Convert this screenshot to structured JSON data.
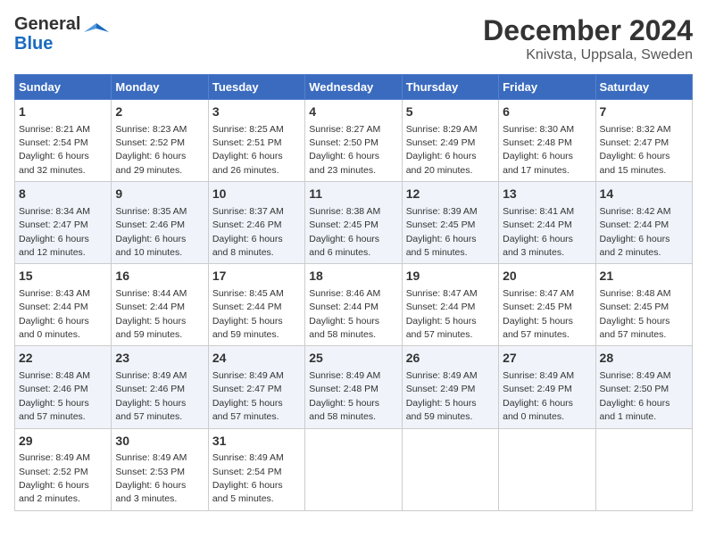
{
  "header": {
    "logo_line1": "General",
    "logo_line2": "Blue",
    "title": "December 2024",
    "subtitle": "Knivsta, Uppsala, Sweden"
  },
  "calendar": {
    "days_of_week": [
      "Sunday",
      "Monday",
      "Tuesday",
      "Wednesday",
      "Thursday",
      "Friday",
      "Saturday"
    ],
    "weeks": [
      [
        {
          "day": "1",
          "detail": "Sunrise: 8:21 AM\nSunset: 2:54 PM\nDaylight: 6 hours\nand 32 minutes."
        },
        {
          "day": "2",
          "detail": "Sunrise: 8:23 AM\nSunset: 2:52 PM\nDaylight: 6 hours\nand 29 minutes."
        },
        {
          "day": "3",
          "detail": "Sunrise: 8:25 AM\nSunset: 2:51 PM\nDaylight: 6 hours\nand 26 minutes."
        },
        {
          "day": "4",
          "detail": "Sunrise: 8:27 AM\nSunset: 2:50 PM\nDaylight: 6 hours\nand 23 minutes."
        },
        {
          "day": "5",
          "detail": "Sunrise: 8:29 AM\nSunset: 2:49 PM\nDaylight: 6 hours\nand 20 minutes."
        },
        {
          "day": "6",
          "detail": "Sunrise: 8:30 AM\nSunset: 2:48 PM\nDaylight: 6 hours\nand 17 minutes."
        },
        {
          "day": "7",
          "detail": "Sunrise: 8:32 AM\nSunset: 2:47 PM\nDaylight: 6 hours\nand 15 minutes."
        }
      ],
      [
        {
          "day": "8",
          "detail": "Sunrise: 8:34 AM\nSunset: 2:47 PM\nDaylight: 6 hours\nand 12 minutes."
        },
        {
          "day": "9",
          "detail": "Sunrise: 8:35 AM\nSunset: 2:46 PM\nDaylight: 6 hours\nand 10 minutes."
        },
        {
          "day": "10",
          "detail": "Sunrise: 8:37 AM\nSunset: 2:46 PM\nDaylight: 6 hours\nand 8 minutes."
        },
        {
          "day": "11",
          "detail": "Sunrise: 8:38 AM\nSunset: 2:45 PM\nDaylight: 6 hours\nand 6 minutes."
        },
        {
          "day": "12",
          "detail": "Sunrise: 8:39 AM\nSunset: 2:45 PM\nDaylight: 6 hours\nand 5 minutes."
        },
        {
          "day": "13",
          "detail": "Sunrise: 8:41 AM\nSunset: 2:44 PM\nDaylight: 6 hours\nand 3 minutes."
        },
        {
          "day": "14",
          "detail": "Sunrise: 8:42 AM\nSunset: 2:44 PM\nDaylight: 6 hours\nand 2 minutes."
        }
      ],
      [
        {
          "day": "15",
          "detail": "Sunrise: 8:43 AM\nSunset: 2:44 PM\nDaylight: 6 hours\nand 0 minutes."
        },
        {
          "day": "16",
          "detail": "Sunrise: 8:44 AM\nSunset: 2:44 PM\nDaylight: 5 hours\nand 59 minutes."
        },
        {
          "day": "17",
          "detail": "Sunrise: 8:45 AM\nSunset: 2:44 PM\nDaylight: 5 hours\nand 59 minutes."
        },
        {
          "day": "18",
          "detail": "Sunrise: 8:46 AM\nSunset: 2:44 PM\nDaylight: 5 hours\nand 58 minutes."
        },
        {
          "day": "19",
          "detail": "Sunrise: 8:47 AM\nSunset: 2:44 PM\nDaylight: 5 hours\nand 57 minutes."
        },
        {
          "day": "20",
          "detail": "Sunrise: 8:47 AM\nSunset: 2:45 PM\nDaylight: 5 hours\nand 57 minutes."
        },
        {
          "day": "21",
          "detail": "Sunrise: 8:48 AM\nSunset: 2:45 PM\nDaylight: 5 hours\nand 57 minutes."
        }
      ],
      [
        {
          "day": "22",
          "detail": "Sunrise: 8:48 AM\nSunset: 2:46 PM\nDaylight: 5 hours\nand 57 minutes."
        },
        {
          "day": "23",
          "detail": "Sunrise: 8:49 AM\nSunset: 2:46 PM\nDaylight: 5 hours\nand 57 minutes."
        },
        {
          "day": "24",
          "detail": "Sunrise: 8:49 AM\nSunset: 2:47 PM\nDaylight: 5 hours\nand 57 minutes."
        },
        {
          "day": "25",
          "detail": "Sunrise: 8:49 AM\nSunset: 2:48 PM\nDaylight: 5 hours\nand 58 minutes."
        },
        {
          "day": "26",
          "detail": "Sunrise: 8:49 AM\nSunset: 2:49 PM\nDaylight: 5 hours\nand 59 minutes."
        },
        {
          "day": "27",
          "detail": "Sunrise: 8:49 AM\nSunset: 2:49 PM\nDaylight: 6 hours\nand 0 minutes."
        },
        {
          "day": "28",
          "detail": "Sunrise: 8:49 AM\nSunset: 2:50 PM\nDaylight: 6 hours\nand 1 minute."
        }
      ],
      [
        {
          "day": "29",
          "detail": "Sunrise: 8:49 AM\nSunset: 2:52 PM\nDaylight: 6 hours\nand 2 minutes."
        },
        {
          "day": "30",
          "detail": "Sunrise: 8:49 AM\nSunset: 2:53 PM\nDaylight: 6 hours\nand 3 minutes."
        },
        {
          "day": "31",
          "detail": "Sunrise: 8:49 AM\nSunset: 2:54 PM\nDaylight: 6 hours\nand 5 minutes."
        },
        {
          "day": "",
          "detail": ""
        },
        {
          "day": "",
          "detail": ""
        },
        {
          "day": "",
          "detail": ""
        },
        {
          "day": "",
          "detail": ""
        }
      ]
    ]
  }
}
